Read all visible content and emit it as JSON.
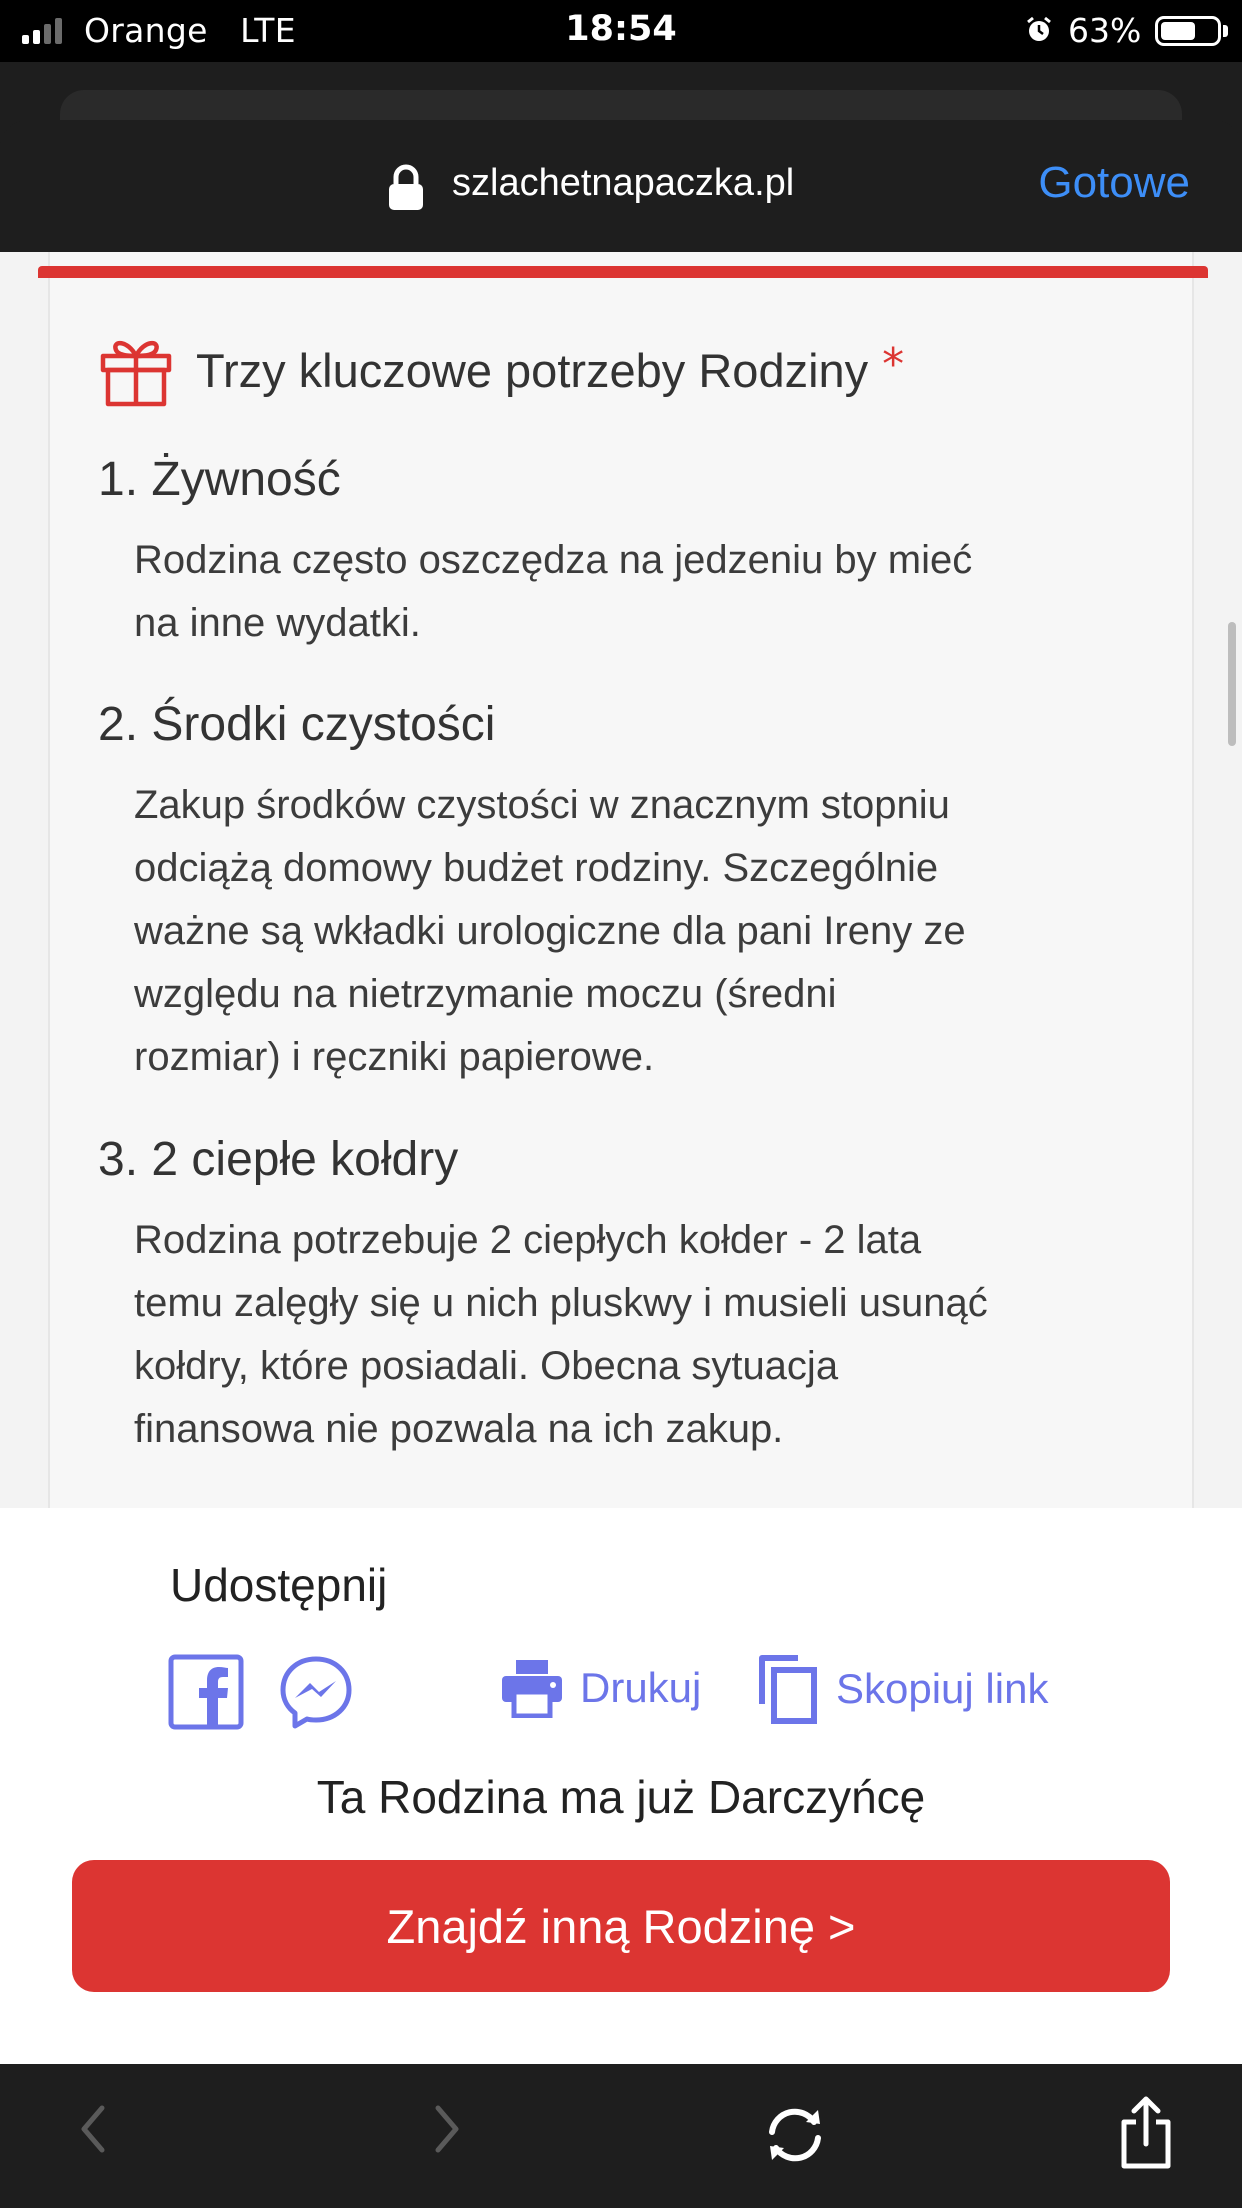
{
  "status_bar": {
    "carrier": "Orange",
    "network": "LTE",
    "time": "18:54",
    "battery_percent": "63%"
  },
  "browser": {
    "domain": "szlachetnapaczka.pl",
    "done_label": "Gotowe",
    "accent": "#3d8ef7"
  },
  "needs": {
    "title": "Trzy kluczowe potrzeby Rodziny",
    "required_mark": "*",
    "items": [
      {
        "heading": "1. Żywność",
        "lines": [
          "Rodzina często oszczędza na jedzeniu by mieć",
          "na inne wydatki."
        ]
      },
      {
        "heading": "2. Środki czystości",
        "lines": [
          "Zakup środków czystości w znacznym stopniu",
          "odciążą domowy budżet rodziny. Szczególnie",
          "ważne są wkładki urologiczne dla pani Ireny ze",
          "względu na nietrzymanie moczu (średni",
          "rozmiar) i ręczniki papierowe."
        ]
      },
      {
        "heading": "3. 2 ciepłe kołdry",
        "lines": [
          "Rodzina potrzebuje 2 ciepłych kołder - 2 lata",
          "temu zalęgły się u nich pluskwy i musieli usunąć",
          "kołdry, które posiadali. Obecna sytuacja",
          "finansowa nie pozwala na ich zakup."
        ]
      }
    ]
  },
  "share": {
    "label": "Udostępnij",
    "print_label": "Drukuj",
    "copy_label": "Skopiuj link",
    "link_color": "#6c75e9"
  },
  "donor": {
    "message": "Ta Rodzina ma już Darczyńcę",
    "cta_label": "Znajdź inną Rodzinę >",
    "brand_color": "#dc3532"
  }
}
